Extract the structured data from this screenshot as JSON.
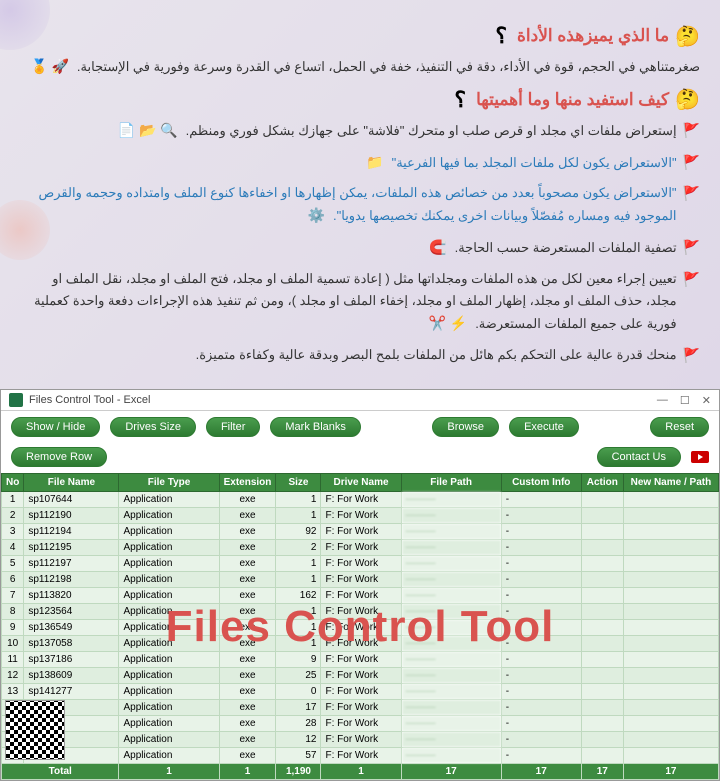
{
  "promo": {
    "title1": "ما الذي يميزهذه الأداة",
    "line1": "صغرمتناهي في الحجم، قوة في الأداء، دقة في التنفيذ، خفة في الحمل، اتساع في القدرة وسرعة وفورية في الإستجابة.",
    "title2": "كيف استفيد منها وما أهميتها",
    "bullets": [
      {
        "text": "إستعراض ملفات اي مجلد او قرص صلب او متحرك \"فلاشة\" على جهازك بشكل فوري ومنظم.",
        "icons": "🔍 📂 📄"
      },
      {
        "text": "\"الاستعراض يكون لكل ملفات المجلد بما فيها الفرعية\"",
        "blue": true,
        "icons": "📁"
      },
      {
        "text": "\"الاستعراض يكون مصحوباً بعدد من خصائص هذه الملفات، يمكن إظهارها او اخفاءها كنوع الملف وامتداده وحجمه والقرص الموجود فيه ومساره مُفصّلاً وبيانات اخرى يمكنك تخصيصها يدويا\".",
        "blue": true,
        "icons": "⚙️"
      },
      {
        "text": "تصفية الملفات المستعرضة حسب الحاجة.",
        "icons": "🧲"
      },
      {
        "text": "تعيين إجراء معين لكل من هذه الملفات ومجلداتها مثل ( إعادة تسمية الملف او مجلد، فتح الملف او مجلد، نقل الملف او مجلد، حذف الملف او مجلد، إظهار الملف او مجلد، إخفاء الملف او مجلد )، ومن ثم تنفيذ هذه الإجراءات دفعة واحدة كعملية فورية على جميع الملفات المستعرضة.",
        "icons": "⚡ ✂️"
      },
      {
        "text": "منحك قدرة عالية على التحكم بكم هائل من الملفات بلمح البصر وبدقة عالية وكفاءة متميزة."
      }
    ]
  },
  "app": {
    "windowTitle": "Files Control Tool - Excel",
    "overlayTitle": "Files Control Tool",
    "toolbar": {
      "showHide": "Show / Hide",
      "drivesSize": "Drives Size",
      "filter": "Filter",
      "markBlanks": "Mark Blanks",
      "browse": "Browse",
      "execute": "Execute",
      "reset": "Reset",
      "removeRow": "Remove Row",
      "contactUs": "Contact Us"
    },
    "columns": {
      "no": "No",
      "fileName": "File Name",
      "fileType": "File Type",
      "extension": "Extension",
      "size": "Size",
      "driveName": "Drive Name",
      "filePath": "File Path",
      "customInfo": "Custom Info",
      "action": "Action",
      "newName": "New Name / Path"
    },
    "rows": [
      {
        "no": 1,
        "name": "sp107644",
        "type": "Application",
        "ext": "exe",
        "size": "1",
        "drive": "F: For Work"
      },
      {
        "no": 2,
        "name": "sp112190",
        "type": "Application",
        "ext": "exe",
        "size": "1",
        "drive": "F: For Work"
      },
      {
        "no": 3,
        "name": "sp112194",
        "type": "Application",
        "ext": "exe",
        "size": "92",
        "drive": "F: For Work"
      },
      {
        "no": 4,
        "name": "sp112195",
        "type": "Application",
        "ext": "exe",
        "size": "2",
        "drive": "F: For Work"
      },
      {
        "no": 5,
        "name": "sp112197",
        "type": "Application",
        "ext": "exe",
        "size": "1",
        "drive": "F: For Work"
      },
      {
        "no": 6,
        "name": "sp112198",
        "type": "Application",
        "ext": "exe",
        "size": "1",
        "drive": "F: For Work"
      },
      {
        "no": 7,
        "name": "sp113820",
        "type": "Application",
        "ext": "exe",
        "size": "162",
        "drive": "F: For Work"
      },
      {
        "no": 8,
        "name": "sp123564",
        "type": "Application",
        "ext": "exe",
        "size": "1",
        "drive": "F: For Work"
      },
      {
        "no": 9,
        "name": "sp136549",
        "type": "Application",
        "ext": "exe",
        "size": "1",
        "drive": "F: For Work"
      },
      {
        "no": 10,
        "name": "sp137058",
        "type": "Application",
        "ext": "exe",
        "size": "1",
        "drive": "F: For Work"
      },
      {
        "no": 11,
        "name": "sp137186",
        "type": "Application",
        "ext": "exe",
        "size": "9",
        "drive": "F: For Work"
      },
      {
        "no": 12,
        "name": "sp138609",
        "type": "Application",
        "ext": "exe",
        "size": "25",
        "drive": "F: For Work"
      },
      {
        "no": 13,
        "name": "sp141277",
        "type": "Application",
        "ext": "exe",
        "size": "0",
        "drive": "F: For Work"
      },
      {
        "no": "",
        "name": "",
        "type": "Application",
        "ext": "exe",
        "size": "17",
        "drive": "F: For Work"
      },
      {
        "no": "",
        "name": "",
        "type": "Application",
        "ext": "exe",
        "size": "28",
        "drive": "F: For Work"
      },
      {
        "no": "",
        "name": "",
        "type": "Application",
        "ext": "exe",
        "size": "12",
        "drive": "F: For Work"
      },
      {
        "no": "",
        "name": "",
        "type": "Application",
        "ext": "exe",
        "size": "57",
        "drive": "F: For Work"
      }
    ],
    "totals": {
      "label": "Total",
      "c1": "1",
      "c2": "1",
      "c3": "1,190",
      "c4": "1",
      "c5": "17",
      "c6": "17",
      "c7": "17",
      "c8": "17"
    }
  }
}
